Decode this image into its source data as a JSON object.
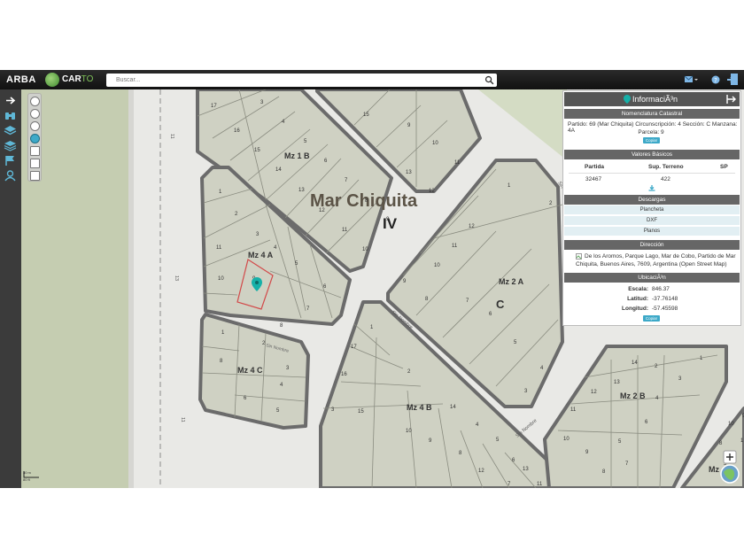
{
  "header": {
    "brand": "ARBA",
    "product": "CAR",
    "product_suffix": "TO",
    "search_placeholder": "Buscar..."
  },
  "map": {
    "city_label": "Mar Chiquita",
    "circunscripcion": "IV",
    "section_label": "C",
    "manzanas": [
      "Mz 1 B",
      "Mz 4 A",
      "Mz 2 A",
      "Mz 4 C",
      "Mz 4 B",
      "Mz 2 B",
      "Mz"
    ],
    "street_labels": [
      "Sin Nombre",
      "Sin Nombre",
      "Sin Nombre",
      "Sin"
    ],
    "road_numbers": [
      "11",
      "13",
      "11"
    ],
    "scale_bar": [
      "30 m",
      "80 ft"
    ],
    "parcels": {
      "mz1b": [
        "17",
        "3",
        "4",
        "16",
        "5",
        "15",
        "6",
        "14",
        "7",
        "13",
        "8",
        "12",
        "9",
        "11",
        "10"
      ],
      "top": [
        "15",
        "9",
        "10",
        "13",
        "11",
        "12"
      ],
      "mz4a": [
        "1",
        "2",
        "3",
        "11",
        "4",
        "5",
        "10",
        "9",
        "6",
        "7",
        "8"
      ],
      "mz2a": [
        "1",
        "12",
        "11",
        "10",
        "9",
        "8",
        "7",
        "6",
        "5",
        "4",
        "3",
        "2"
      ],
      "mz4c": [
        "1",
        "2",
        "8",
        "3",
        "4",
        "6",
        "5"
      ],
      "mz4b": [
        "1",
        "17",
        "2",
        "16",
        "3",
        "15",
        "14",
        "4",
        "5",
        "6",
        "7",
        "8",
        "9",
        "10",
        "11",
        "12",
        "13"
      ],
      "mz2b": [
        "1",
        "2",
        "14",
        "13",
        "12",
        "11",
        "10",
        "9",
        "8",
        "7",
        "6",
        "5",
        "4",
        "3"
      ],
      "right": [
        "8",
        "10",
        "9",
        "1",
        "3"
      ]
    }
  },
  "panel": {
    "title": "InformaciÃ³n",
    "catastral": {
      "header": "Nomenclatura Catastral",
      "line1": "Partido: 69 (Mar Chiquita) Circunscripción: 4 Sección: C Manzana: 4A",
      "line2": "Parcela: 9",
      "copy": "Copiar"
    },
    "valores": {
      "header": "Valores Básicos",
      "columns": [
        "Partida",
        "Sup. Terreno",
        "SP"
      ],
      "values": [
        "32467",
        "422",
        ""
      ]
    },
    "descargas": {
      "header": "Descargas",
      "items": [
        "Plancheta",
        "DXF",
        "Planos"
      ]
    },
    "direccion": {
      "header": "Dirección",
      "line1": "De los Aromos, Parque Lago, Mar de Cobo, Partido de Mar",
      "line2": "Chiquita, Buenos Aires, 7609, Argentina (Open Street Map)"
    },
    "ubicacion": {
      "header": "UbicaciÃ³n",
      "escala_label": "Escala:",
      "escala": "846.37",
      "latitud_label": "Latitud:",
      "latitud": "-37.76148",
      "longitud_label": "Longitud:",
      "longitud": "-57.45598",
      "copy": "Copiar"
    }
  },
  "colors": {
    "block_fill": "#cfd1c3",
    "block_stroke": "#6b6b6b",
    "green_area": "#c5cdb1",
    "panel_accent": "#3da9c8",
    "marker": "#16b0a8"
  }
}
